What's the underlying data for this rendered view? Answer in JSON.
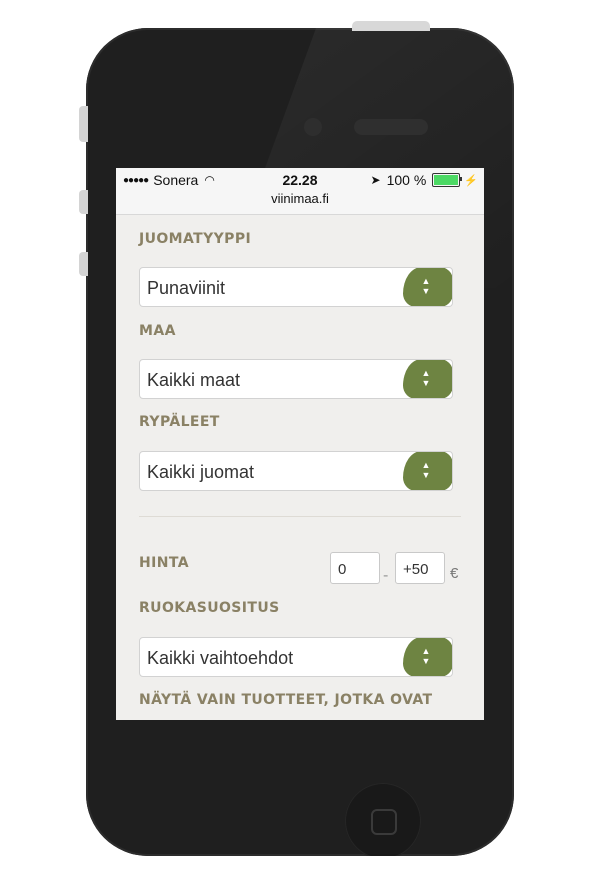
{
  "device": {
    "status": {
      "carrier": "Sonera",
      "signal": "●●●●●",
      "time": "22.28",
      "battery_percent": "100 %",
      "url": "viinimaa.fi"
    }
  },
  "filters": {
    "drink_type": {
      "label": "JUOMATYYPPI",
      "value": "Punaviinit"
    },
    "country": {
      "label": "MAA",
      "value": "Kaikki maat"
    },
    "grapes": {
      "label": "RYPÄLEET",
      "value": "Kaikki juomat"
    },
    "price": {
      "label": "HINTA",
      "min": "0",
      "max": "+50",
      "currency": "€",
      "separator": "-"
    },
    "food": {
      "label": "RUOKASUOSITUS",
      "value": "Kaikki vaihtoehdot"
    },
    "show_only": {
      "label": "NÄYTÄ VAIN TUOTTEET, JOTKA OVAT"
    }
  },
  "colors": {
    "accent_green": "#6e8442",
    "label_color": "#8a8165"
  }
}
